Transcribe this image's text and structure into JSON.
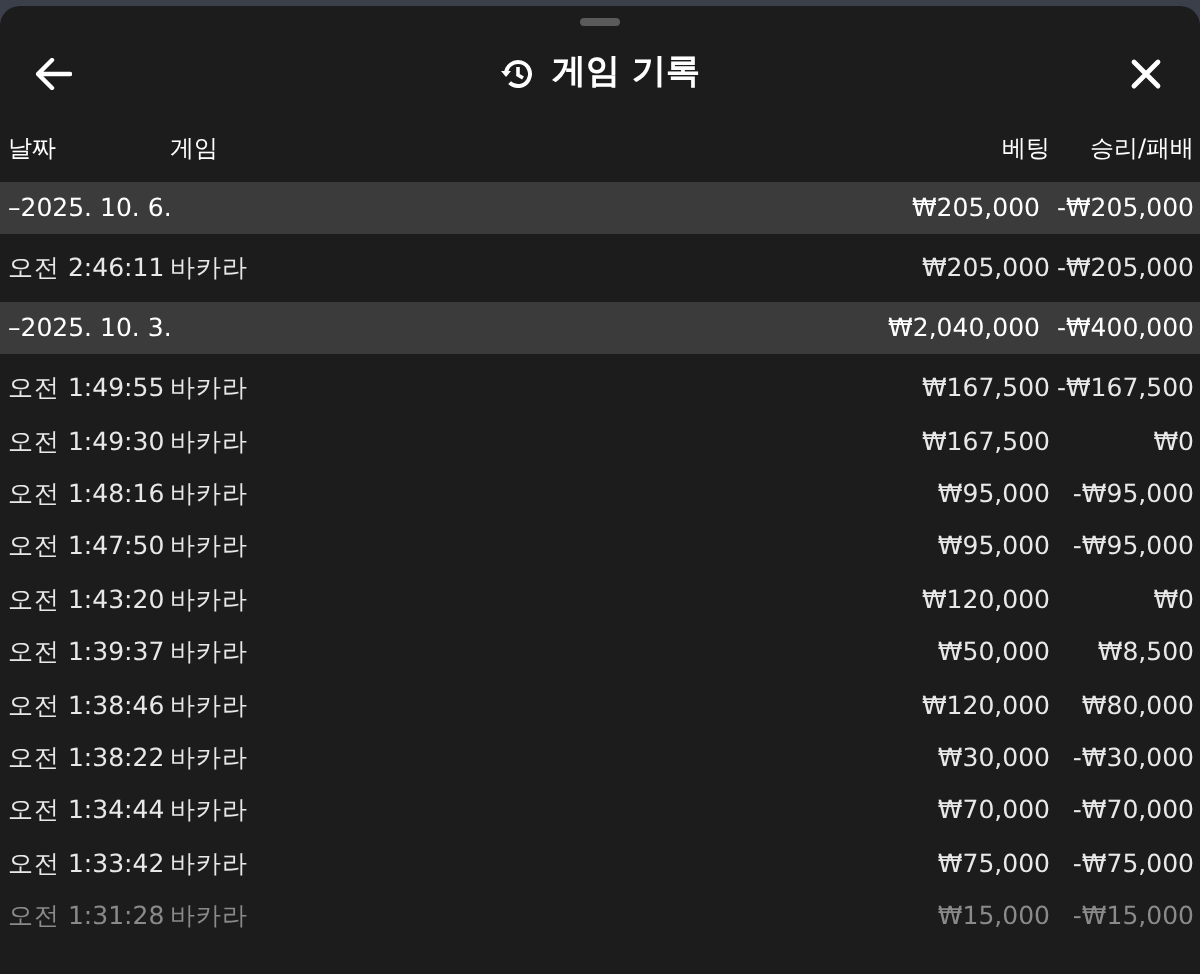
{
  "header": {
    "title": "게임 기록"
  },
  "columns": [
    "날짜",
    "게임",
    "베팅",
    "승리/패배"
  ],
  "rows": [
    {
      "kind": "group",
      "date": "–2025. 10. 6.",
      "bet": "₩205,000",
      "result": "-₩205,000"
    },
    {
      "kind": "entry",
      "time": "오전 2:46:11",
      "game": "바카라",
      "bet": "₩205,000",
      "result": "-₩205,000",
      "dimmed": false
    },
    {
      "kind": "group",
      "date": "–2025. 10. 3.",
      "bet": "₩2,040,000",
      "result": "-₩400,000"
    },
    {
      "kind": "entry",
      "time": "오전 1:49:55",
      "game": "바카라",
      "bet": "₩167,500",
      "result": "-₩167,500",
      "dimmed": false
    },
    {
      "kind": "entry",
      "time": "오전 1:49:30",
      "game": "바카라",
      "bet": "₩167,500",
      "result": "₩0",
      "dimmed": false
    },
    {
      "kind": "entry",
      "time": "오전 1:48:16",
      "game": "바카라",
      "bet": "₩95,000",
      "result": "-₩95,000",
      "dimmed": false
    },
    {
      "kind": "entry",
      "time": "오전 1:47:50",
      "game": "바카라",
      "bet": "₩95,000",
      "result": "-₩95,000",
      "dimmed": false
    },
    {
      "kind": "entry",
      "time": "오전 1:43:20",
      "game": "바카라",
      "bet": "₩120,000",
      "result": "₩0",
      "dimmed": false
    },
    {
      "kind": "entry",
      "time": "오전 1:39:37",
      "game": "바카라",
      "bet": "₩50,000",
      "result": "₩8,500",
      "dimmed": false
    },
    {
      "kind": "entry",
      "time": "오전 1:38:46",
      "game": "바카라",
      "bet": "₩120,000",
      "result": "₩80,000",
      "dimmed": false
    },
    {
      "kind": "entry",
      "time": "오전 1:38:22",
      "game": "바카라",
      "bet": "₩30,000",
      "result": "-₩30,000",
      "dimmed": false
    },
    {
      "kind": "entry",
      "time": "오전 1:34:44",
      "game": "바카라",
      "bet": "₩70,000",
      "result": "-₩70,000",
      "dimmed": false
    },
    {
      "kind": "entry",
      "time": "오전 1:33:42",
      "game": "바카라",
      "bet": "₩75,000",
      "result": "-₩75,000",
      "dimmed": false
    },
    {
      "kind": "entry",
      "time": "오전 1:31:28",
      "game": "바카라",
      "bet": "₩15,000",
      "result": "-₩15,000",
      "dimmed": true
    }
  ]
}
